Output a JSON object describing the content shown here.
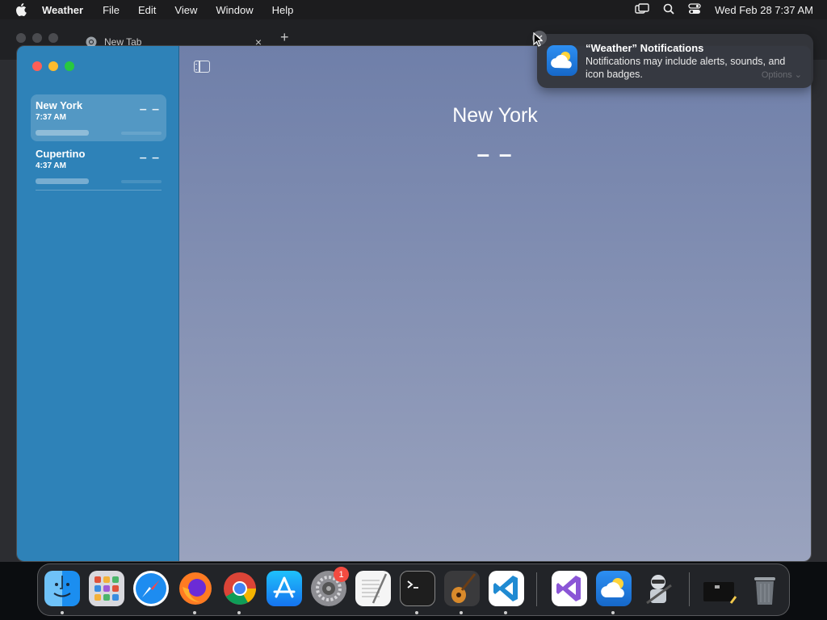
{
  "menubar": {
    "app_name": "Weather",
    "items": [
      "File",
      "Edit",
      "View",
      "Window",
      "Help"
    ],
    "clock": "Wed Feb 28  7:37 AM",
    "status_icons": [
      "screen-mirroring-icon",
      "spotlight-icon",
      "control-center-icon"
    ]
  },
  "browser": {
    "tab_title": "New Tab",
    "tab_close": "×",
    "new_tab": "+"
  },
  "weather": {
    "locations": [
      {
        "name": "New York",
        "time": "7:37 AM",
        "temp": "– –",
        "selected": true
      },
      {
        "name": "Cupertino",
        "time": "4:37 AM",
        "temp": "– –",
        "selected": false
      }
    ],
    "current": {
      "name": "New York",
      "temp": "– –"
    }
  },
  "notification": {
    "title": "“Weather” Notifications",
    "body": "Notifications may include alerts, sounds, and icon badges.",
    "options": "Options ⌄"
  },
  "dock": {
    "apps": [
      "Finder",
      "Launchpad",
      "Safari",
      "Firefox",
      "Chrome",
      "App Store",
      "System Settings",
      "TextEdit",
      "Terminal",
      "GarageBand",
      "Visual Studio Code",
      "Visual Studio",
      "Weather",
      "Automator",
      "Downloads",
      "Trash"
    ],
    "settings_badge": "1"
  },
  "colors": {
    "sidebar": "#2e82b8",
    "main_top": "#6f7fa9",
    "main_bottom": "#9aa3be",
    "badge": "#f34b41"
  }
}
